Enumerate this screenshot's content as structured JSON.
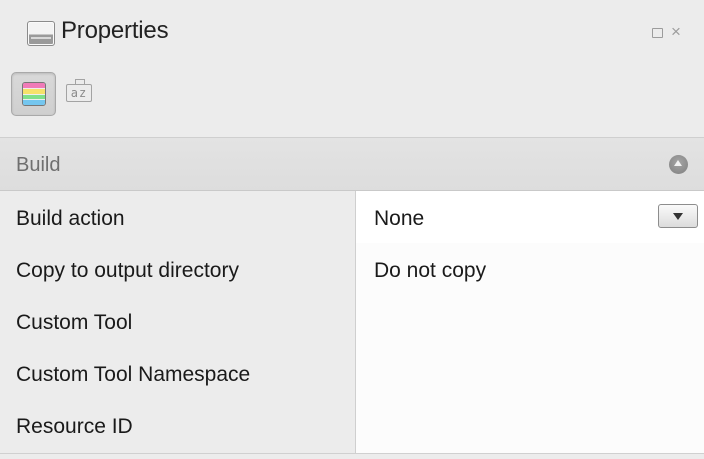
{
  "panel": {
    "title": "Properties",
    "title_icon": "properties-pad-icon",
    "window_controls": {
      "maximize_icon": "maximize-icon",
      "close_icon": "close-icon",
      "close_glyph": "×"
    }
  },
  "toolbar": {
    "categorized_button_icon": "categorized-view-icon",
    "categorized_active": true,
    "alphabetical_button_icon": "sort-alphabetical-icon",
    "alphabetical_glyph": "az"
  },
  "category": {
    "label": "Build",
    "collapse_icon": "collapse-up-icon"
  },
  "properties": [
    {
      "name": "Build action",
      "value": "None",
      "has_dropdown": true
    },
    {
      "name": "Copy to output directory",
      "value": "Do not copy",
      "has_dropdown": false
    },
    {
      "name": "Custom Tool",
      "value": "",
      "has_dropdown": false
    },
    {
      "name": "Custom Tool Namespace",
      "value": "",
      "has_dropdown": false
    },
    {
      "name": "Resource ID",
      "value": "",
      "has_dropdown": false
    }
  ],
  "colors": {
    "category_stripes": [
      "#f07bb8",
      "#f5e26a",
      "#7fe08a",
      "#74c6ef"
    ]
  }
}
